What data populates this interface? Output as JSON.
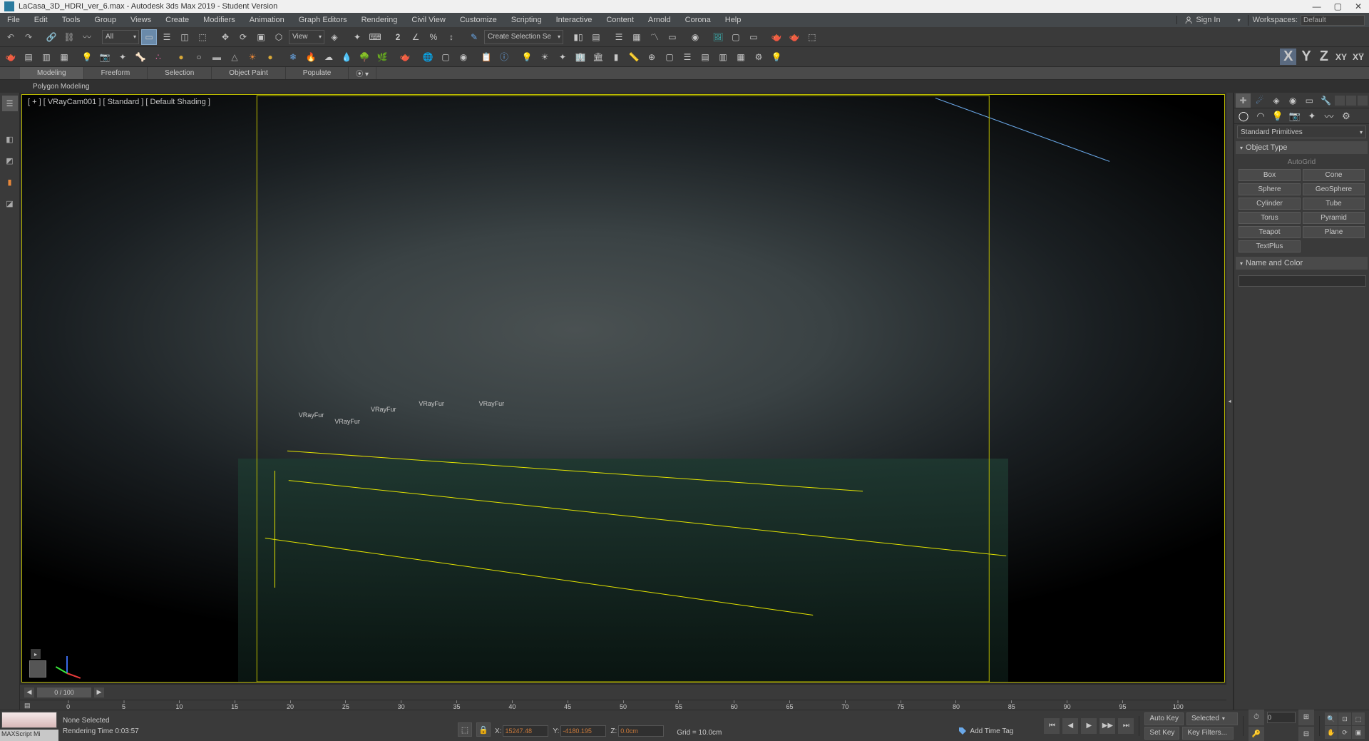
{
  "titlebar": {
    "filename": "LaCasa_3D_HDRI_ver_6.max - Autodesk 3ds Max 2019 - Student Version"
  },
  "menubar": {
    "items": [
      "File",
      "Edit",
      "Tools",
      "Group",
      "Views",
      "Create",
      "Modifiers",
      "Animation",
      "Graph Editors",
      "Rendering",
      "Civil View",
      "Customize",
      "Scripting",
      "Interactive",
      "Content",
      "Arnold",
      "Corona",
      "Help"
    ],
    "signin": "Sign In",
    "workspaces_label": "Workspaces:",
    "workspaces_value": "Default"
  },
  "toolbar1": {
    "filter_all": "All",
    "view_dd": "View",
    "create_sel": "Create Selection Se"
  },
  "ribbon": {
    "tabs": [
      "Modeling",
      "Freeform",
      "Selection",
      "Object Paint",
      "Populate"
    ],
    "active": 0,
    "sub": [
      "Polygon Modeling"
    ]
  },
  "viewport": {
    "label": "[ + ] [ VRayCam001 ] [ Standard ] [ Default Shading ]",
    "scene_labels": [
      "VRayFur",
      "VRayFur",
      "VRayFur",
      "VRayFur",
      "VRayFur"
    ]
  },
  "cmd_panel": {
    "category": "Standard Primitives",
    "rollout_type": "Object Type",
    "autogrid": "AutoGrid",
    "buttons": [
      "Box",
      "Cone",
      "Sphere",
      "GeoSphere",
      "Cylinder",
      "Tube",
      "Torus",
      "Pyramid",
      "Teapot",
      "Plane",
      "TextPlus"
    ],
    "rollout_name": "Name and Color"
  },
  "timeline": {
    "frame_display": "0 / 100",
    "ticks": [
      0,
      5,
      10,
      15,
      20,
      25,
      30,
      35,
      40,
      45,
      50,
      55,
      60,
      65,
      70,
      75,
      80,
      85,
      90,
      95,
      100
    ]
  },
  "status": {
    "script_label": "MAXScript Mi",
    "selection": "None Selected",
    "render_time": "Rendering Time  0:03:57",
    "x": "15247.48",
    "y": "-4180.195",
    "z": "0.0cm",
    "grid": "Grid = 10.0cm",
    "time_tag": "Add Time Tag",
    "auto_key": "Auto Key",
    "set_key": "Set Key",
    "selected_dd": "Selected",
    "key_filters": "Key Filters..."
  }
}
